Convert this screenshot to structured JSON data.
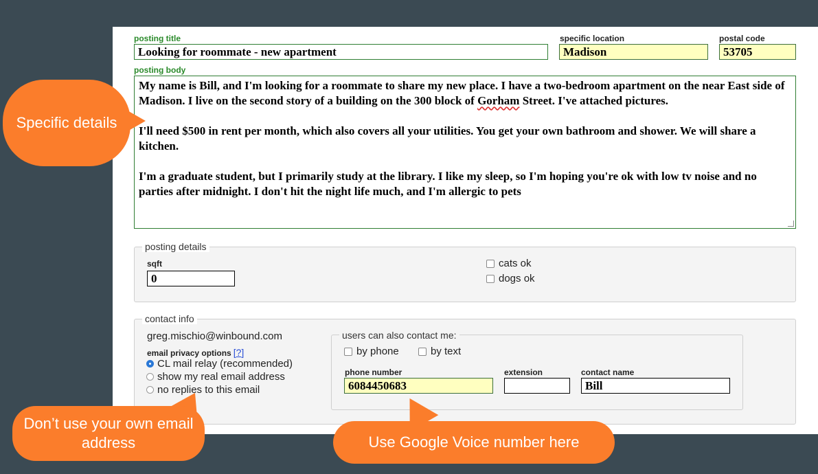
{
  "posting_title": {
    "label": "posting title",
    "value": "Looking for roommate - new apartment"
  },
  "specific_location": {
    "label": "specific location",
    "value": "Madison"
  },
  "postal_code": {
    "label": "postal code",
    "value": "53705"
  },
  "posting_body": {
    "label": "posting body",
    "p1_pre": "My name is Bill, and I'm looking for a roommate to share my new place. I have a two-bedroom apartment on the near East side of Madison. I live on the second story of a building on the 300 block of ",
    "p1_mark": "Gorham",
    "p1_post": " Street. I've attached pictures.",
    "p2": "I'll need $500 in rent per month, which also covers all your utilities. You get your own bathroom and shower.  We will share a kitchen.",
    "p3": "I'm a graduate student, but I primarily study at the library.  I like my sleep, so I'm hoping you're ok with low tv noise and no parties after midnight. I don't hit the night life much, and I'm allergic to pets"
  },
  "posting_details": {
    "legend": "posting details",
    "sqft_label": "sqft",
    "sqft_value": "0",
    "cats_label": "cats ok",
    "dogs_label": "dogs ok"
  },
  "contact_info": {
    "legend": "contact info",
    "email": "greg.mischio@winbound.com",
    "privacy_label": "email privacy options",
    "privacy_help": "[?]",
    "options": [
      {
        "label": "CL mail relay (recommended)",
        "selected": true
      },
      {
        "label": "show my real email address",
        "selected": false
      },
      {
        "label": "no replies to this email",
        "selected": false
      }
    ],
    "also_contact": {
      "legend": "users can also contact me:",
      "by_phone": "by phone",
      "by_text": "by text",
      "phone_label": "phone number",
      "phone_value": "6084450683",
      "extension_label": "extension",
      "extension_value": "",
      "contact_name_label": "contact name",
      "contact_name_value": "Bill"
    }
  },
  "callouts": {
    "specific_details": "Specific details",
    "email_tip": "Don’t use your own email address",
    "phone_tip": "Use Google Voice number here"
  },
  "colors": {
    "background": "#3b4a53",
    "accent_orange": "#fb7d2b",
    "label_green": "#2a8a2a",
    "field_yellow": "#ffffc0"
  }
}
